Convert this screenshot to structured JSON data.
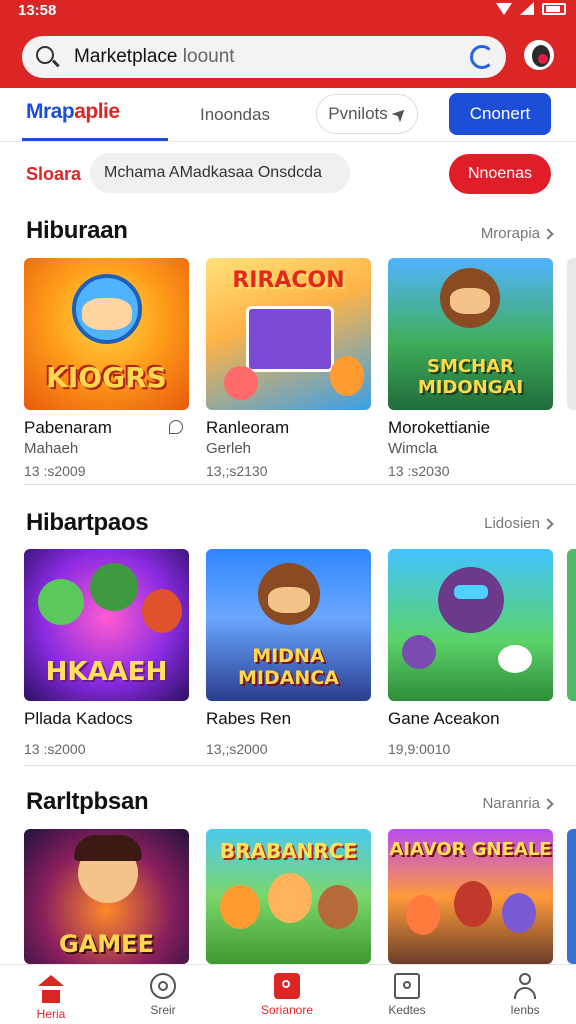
{
  "status_bar": {
    "time": "13:58"
  },
  "header": {
    "search_text": "Marketplace",
    "search_hint": "loount"
  },
  "tabs": {
    "brand_part1": "Mrap",
    "brand_part2": "aplie",
    "tab2": "Inoondas",
    "tab3": "Pvnilots",
    "button": "Cnonert"
  },
  "filter": {
    "label": "Sloara",
    "chip": "Mchama AMadkasaa Onsdcda",
    "button": "Nnoenas"
  },
  "sections": [
    {
      "title": "Hiburaan",
      "more": "Mrorapia",
      "cards": [
        {
          "art_title": "KIOGRS",
          "name": "Pabenaram",
          "sub": "Mahaeh",
          "date": "13 :s2009"
        },
        {
          "art_title": "RIRACON",
          "name": "Ranleoram",
          "sub": "Gerleh",
          "date": "13,;s2130"
        },
        {
          "art_title": "SMCHAR MIDONGAI",
          "name": "Morokettianie",
          "sub": "Wimcla",
          "date": "13 :s2030"
        }
      ]
    },
    {
      "title": "Hibartpaos",
      "more": "Lidosien",
      "cards": [
        {
          "art_title": "HKAAEH",
          "name": "Pllada Kadocs",
          "sub": "",
          "date": "13 :s2000"
        },
        {
          "art_title": "MIDNA MIDANCA",
          "name": "Rabes Ren",
          "sub": "",
          "date": "13,;s2000"
        },
        {
          "art_title": "",
          "name": "Gane Aceakon",
          "sub": "",
          "date": "19,9:0010"
        }
      ]
    },
    {
      "title": "Rarltpbsan",
      "more": "Naranria",
      "cards": [
        {
          "art_title": "GAMEE",
          "name": "",
          "sub": "",
          "date": ""
        },
        {
          "art_title": "BRABANRCE",
          "name": "",
          "sub": "",
          "date": ""
        },
        {
          "art_title": "AIAVOR GNEALE",
          "name": "",
          "sub": "",
          "date": ""
        }
      ]
    }
  ],
  "bottom_nav": [
    {
      "label": "Heria",
      "icon": "home-icon"
    },
    {
      "label": "Sreir",
      "icon": "target-icon"
    },
    {
      "label": "Sorianore",
      "icon": "shopping-bag-icon"
    },
    {
      "label": "Kedtes",
      "icon": "box-icon"
    },
    {
      "label": "Ienbs",
      "icon": "user-icon"
    }
  ],
  "colors": {
    "primary_red": "#dc2626",
    "primary_blue": "#1d4ed8"
  }
}
